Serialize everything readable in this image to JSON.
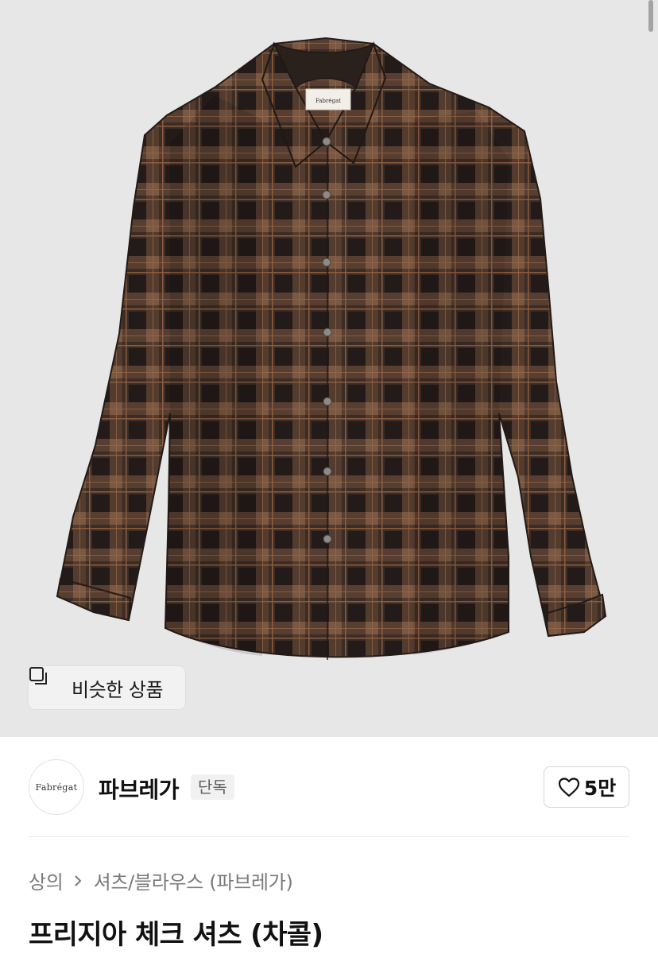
{
  "product_image": {
    "alt_brand_tag": "Fabrégat",
    "background": "#e7e7e7"
  },
  "similar_button": {
    "label": "비슷한 상품",
    "icon": "stacked-squares-icon"
  },
  "brand": {
    "logo_text": "Fabrégat",
    "name": "파브레가",
    "badge": "단독"
  },
  "like": {
    "icon": "heart-outline-icon",
    "count": "5만"
  },
  "breadcrumb": {
    "category": "상의",
    "subcategory": "셔츠/블라우스 (파브레가)"
  },
  "title": "프리지아 체크 셔츠 (차콜)"
}
